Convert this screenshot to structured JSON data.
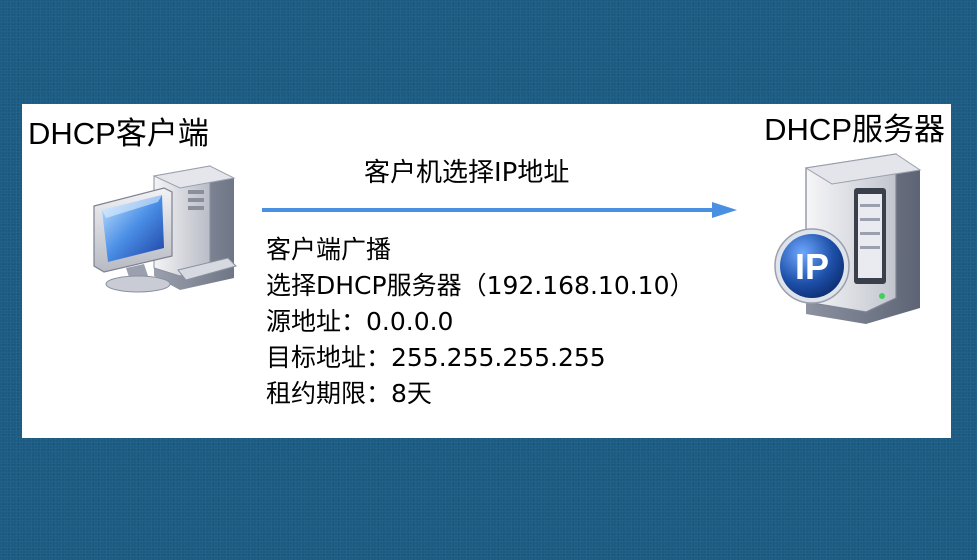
{
  "client": {
    "label": "DHCP客户端",
    "icon": "computer-icon"
  },
  "server": {
    "label": "DHCP服务器",
    "icon": "server-icon",
    "badge_text": "IP"
  },
  "arrow": {
    "caption": "客户机选择IP地址",
    "color": "#4a90e2"
  },
  "message": {
    "lines": [
      "客户端广播",
      "选择DHCP服务器（192.168.10.10）",
      "源地址：0.0.0.0",
      "目标地址：255.255.255.255",
      "租约期限：8天"
    ]
  },
  "colors": {
    "background": "#1a5b83",
    "panel": "#ffffff",
    "arrow": "#4a90e2",
    "badge": "#1d4fa8"
  }
}
